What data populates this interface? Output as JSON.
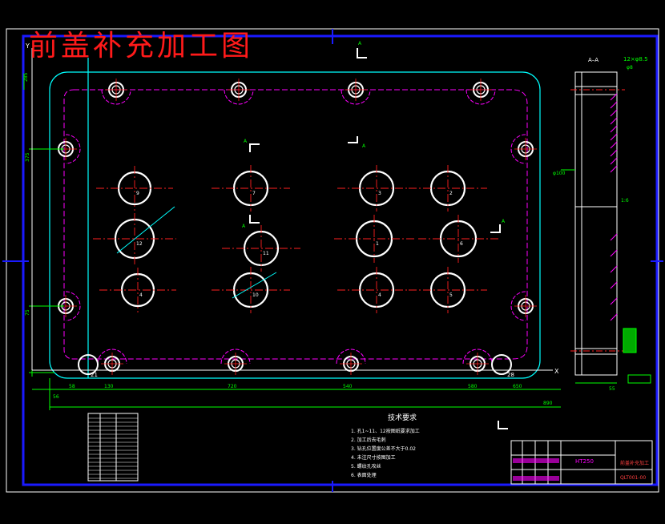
{
  "drawing": {
    "overlay_title": "前盖补充加工图",
    "section_label": "A–A",
    "section_mark": "A",
    "axis_x": "X",
    "axis_y": "Y"
  },
  "dimensions": {
    "bottom": [
      "58",
      "130",
      "720",
      "540",
      "580",
      "650"
    ],
    "bottom_origin": "56",
    "overall_width": "890",
    "left": [
      "375",
      "75"
    ],
    "top_offset": "285",
    "side_callouts": [
      "12×φ8.5",
      "φ8",
      "φ100",
      "1:6"
    ],
    "side_bottom": "55"
  },
  "hole_labels": [
    "9",
    "7",
    "3",
    "2",
    "12",
    "11",
    "1",
    "6",
    "4",
    "10",
    "4",
    "5"
  ],
  "edge_labels": [
    "21",
    "28"
  ],
  "tech": {
    "heading": "技术要求",
    "items": [
      "1. 孔1~11、12按图纸要求加工",
      "2. 加工后去毛刺",
      "3. 钻孔位置度公差不大于0.02",
      "4. 未注尺寸按图加工",
      "5. 螺纹孔攻丝",
      "6. 表面处理"
    ]
  },
  "title_block": {
    "material": "HT250",
    "name": "前盖补充加工",
    "code": "QLT001-00"
  },
  "colors": {
    "frame": "#1a1aff",
    "outline": "#00ffff",
    "inner": "#ff00ff",
    "holes": "#ffffff",
    "center": "#ff2020",
    "dims": "#00ff00",
    "title_red": "#ff1a1a"
  }
}
